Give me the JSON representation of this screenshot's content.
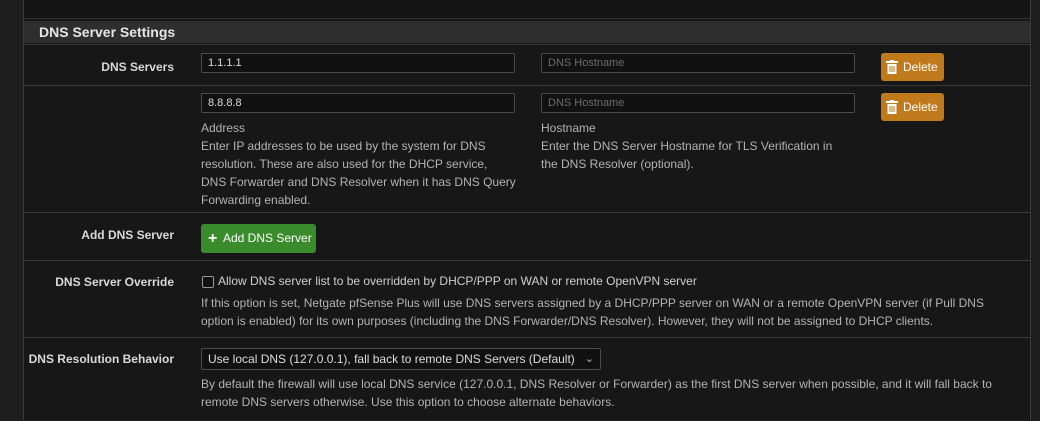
{
  "section": {
    "title": "DNS Server Settings"
  },
  "dns_servers": {
    "label": "DNS Servers",
    "entries": [
      {
        "address": "1.1.1.1",
        "hostname_placeholder": "DNS Hostname",
        "delete_label": "Delete"
      },
      {
        "address": "8.8.8.8",
        "hostname_placeholder": "DNS Hostname",
        "delete_label": "Delete"
      }
    ],
    "address_title": "Address",
    "address_help": [
      "Enter IP addresses to be used by the system for DNS",
      "resolution. These are also used for the DHCP service,",
      "DNS Forwarder and DNS Resolver when it has DNS Query",
      "Forwarding enabled."
    ],
    "hostname_title": "Hostname",
    "hostname_help": [
      "Enter the DNS Server Hostname for TLS Verification in",
      "the DNS Resolver (optional)."
    ]
  },
  "add_dns": {
    "label": "Add DNS Server",
    "button_label": "Add DNS Server"
  },
  "override": {
    "label": "DNS Server Override",
    "checkbox_label": "Allow DNS server list to be overridden by DHCP/PPP on WAN or remote OpenVPN server",
    "checked": false,
    "help": [
      "If this option is set, Netgate pfSense Plus will use DNS servers assigned by a DHCP/PPP server on WAN or a remote OpenVPN server (if Pull DNS",
      "option is enabled) for its own purposes (including the DNS Forwarder/DNS Resolver). However, they will not be assigned to DHCP clients."
    ]
  },
  "resolution": {
    "label": "DNS Resolution Behavior",
    "selected": "Use local DNS (127.0.0.1), fall back to remote DNS Servers (Default)",
    "help": [
      "By default the firewall will use local DNS service (127.0.0.1, DNS Resolver or Forwarder) as the first DNS server when possible, and it will fall back to",
      "remote DNS servers otherwise. Use this option to choose alternate behaviors."
    ]
  },
  "colors": {
    "delete": "#c07a1b",
    "add": "#3a8b2c",
    "background": "#171717"
  },
  "icons": {
    "delete": "trash-icon",
    "add": "plus-icon",
    "select": "chevron-down-icon"
  }
}
